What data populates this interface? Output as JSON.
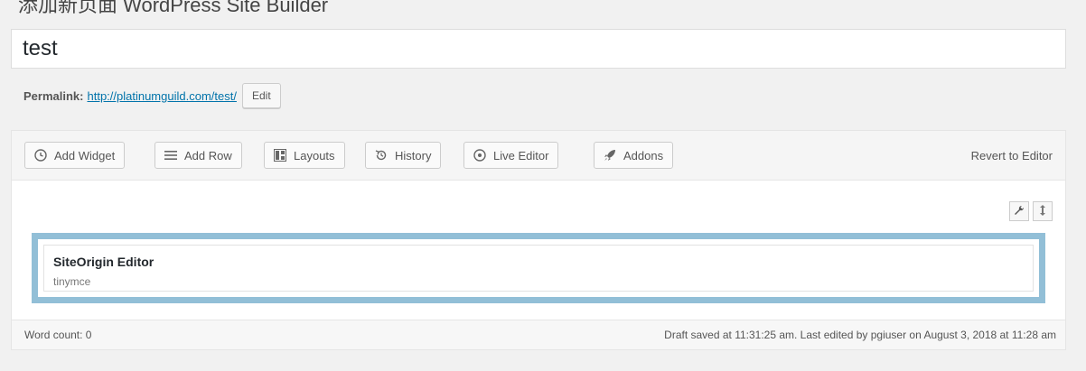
{
  "header": {
    "top_text": "添加新页面 WordPress Site Builder"
  },
  "post": {
    "title_value": "test"
  },
  "permalink": {
    "label": "Permalink:",
    "url": "http://platinumguild.com/test/",
    "edit_label": "Edit"
  },
  "toolbar": {
    "add_widget": "Add Widget",
    "add_row": "Add Row",
    "layouts": "Layouts",
    "history": "History",
    "live_editor": "Live Editor",
    "addons": "Addons",
    "revert": "Revert to Editor"
  },
  "widget": {
    "title": "SiteOrigin Editor",
    "subtitle": "tinymce"
  },
  "status": {
    "word_count": "Word count: 0",
    "draft_info": "Draft saved at 11:31:25 am. Last edited by pgiuser on August 3, 2018 at 11:28 am"
  },
  "icons": {
    "add_widget": "clock-circle-icon",
    "add_row": "hamburger-lines-icon",
    "layouts": "layout-grid-icon",
    "history": "history-arrow-icon",
    "live_editor": "eye-circle-icon",
    "addons": "rocket-icon",
    "row_settings": "wrench-icon",
    "row_move": "move-vertical-icon"
  },
  "colors": {
    "link": "#0073aa",
    "cell_border": "#92bfd7"
  }
}
